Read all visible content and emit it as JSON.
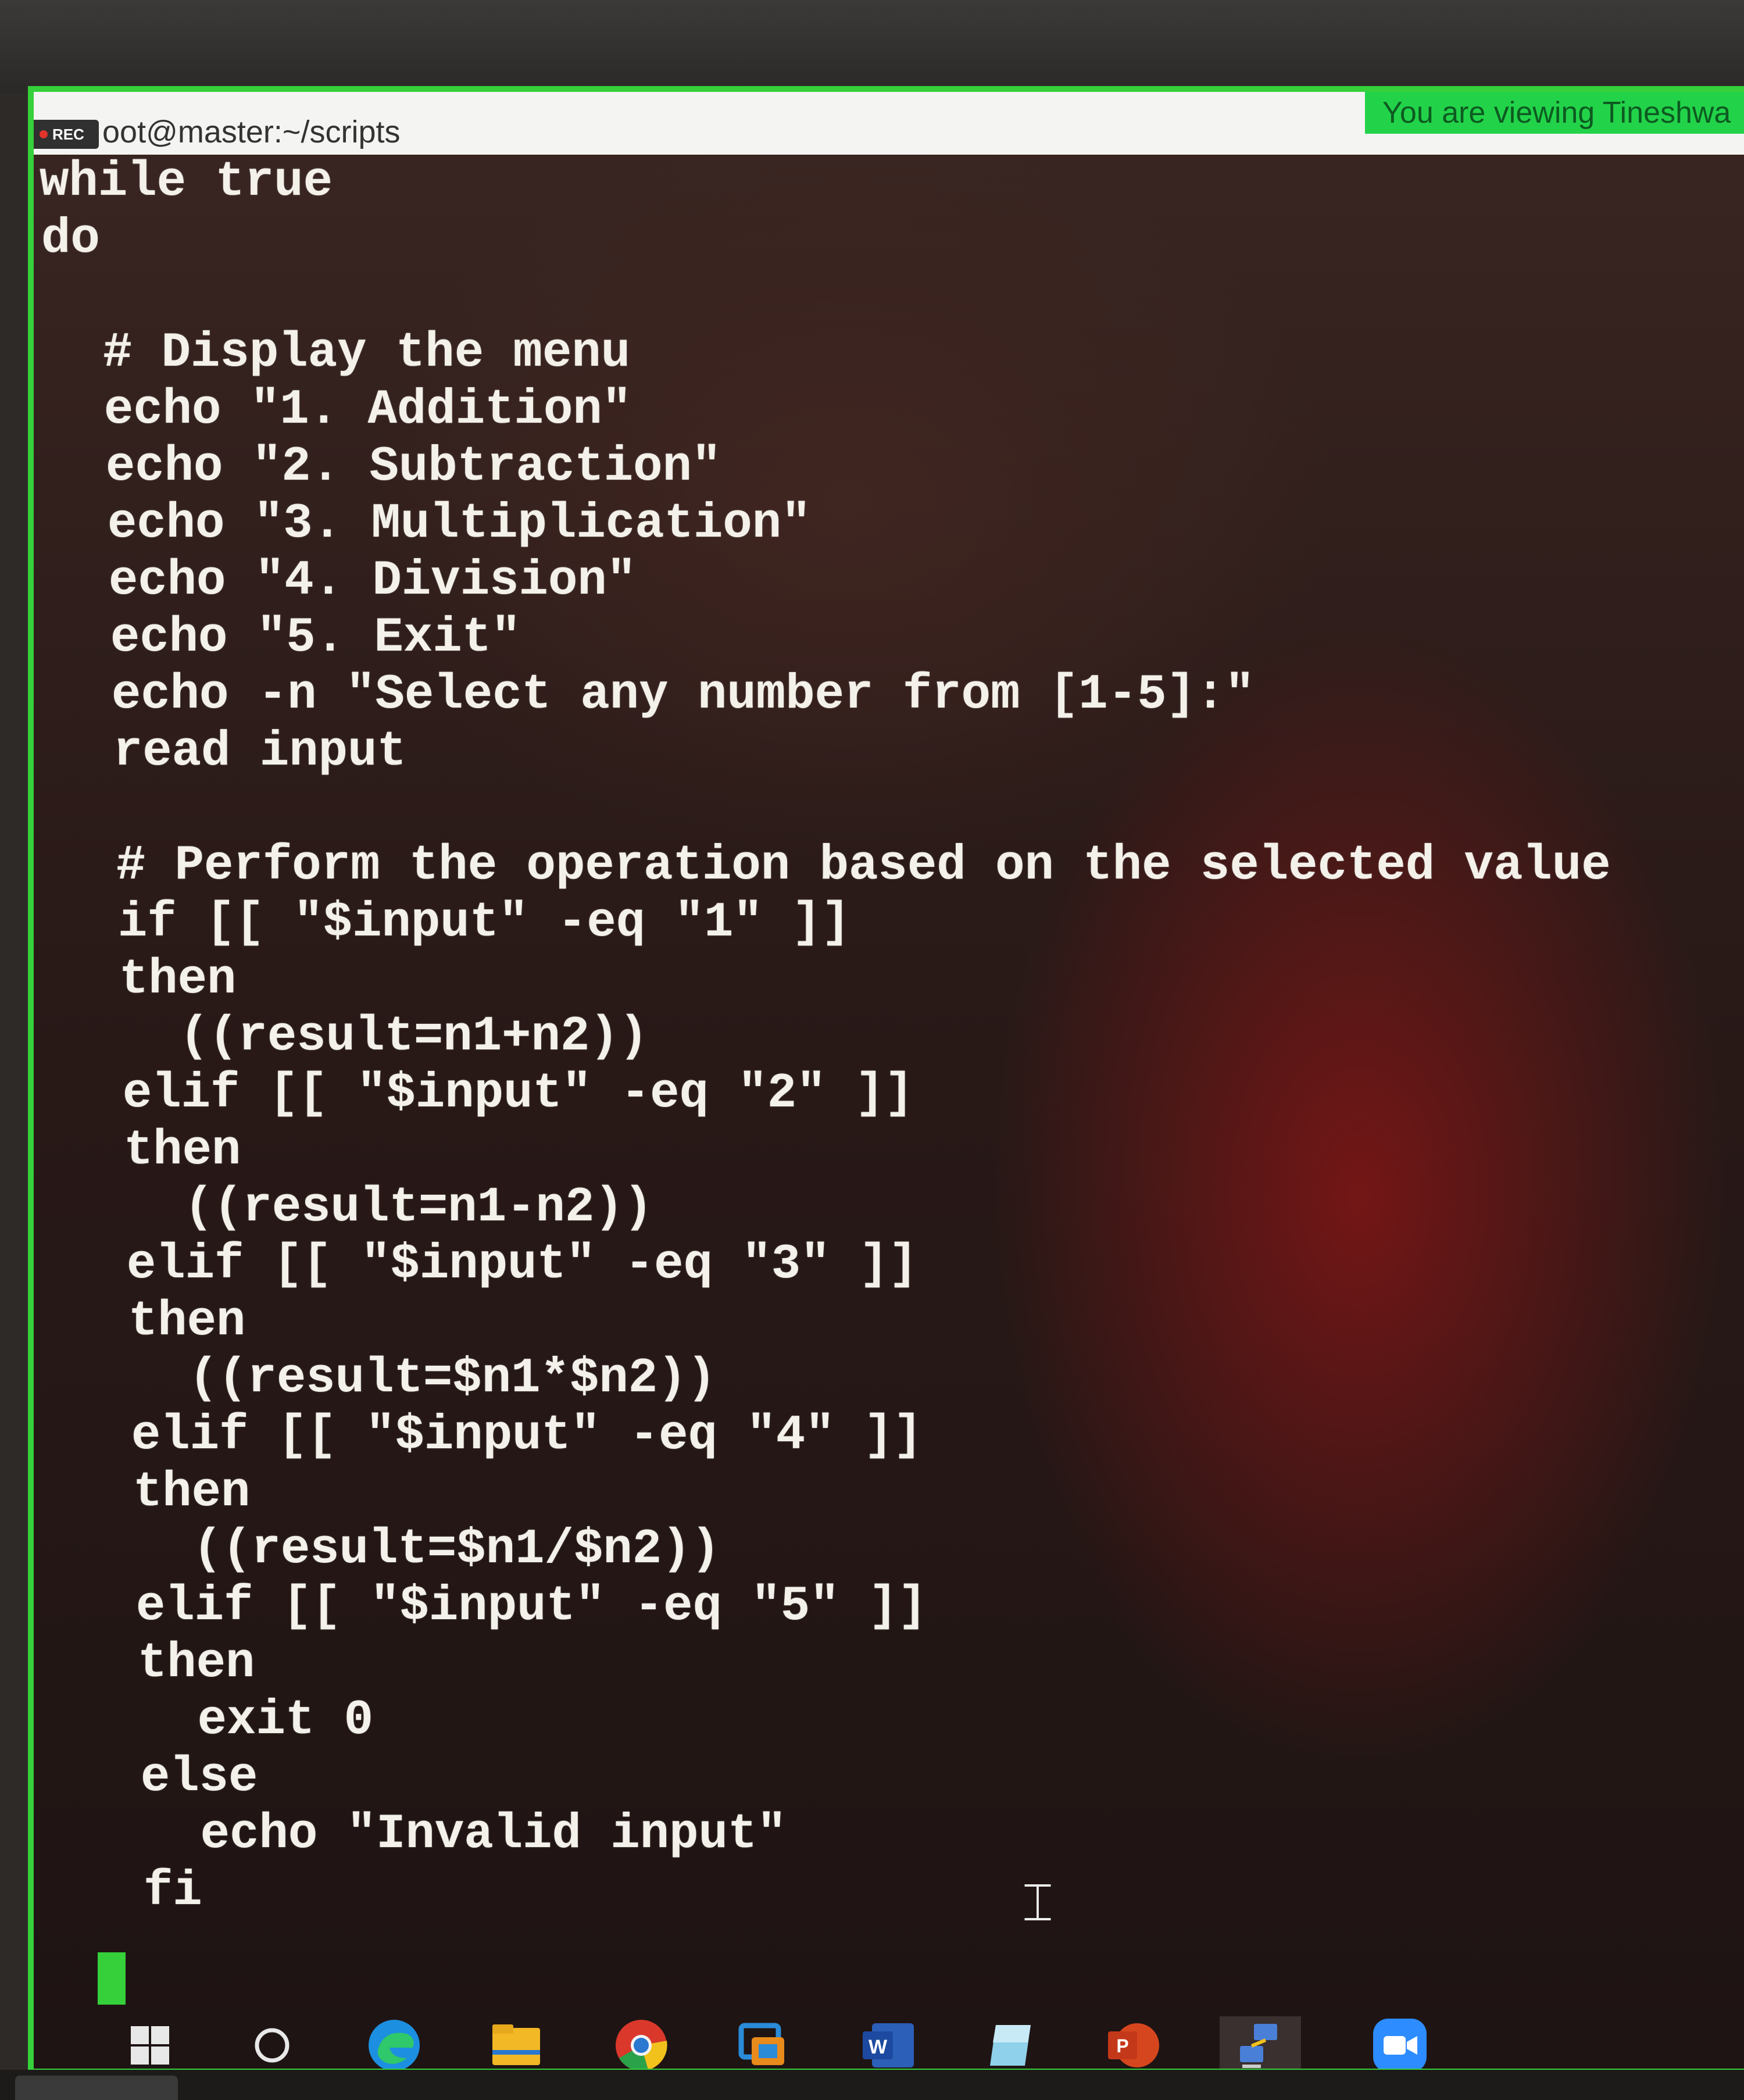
{
  "recording": {
    "label": "REC"
  },
  "window": {
    "title": "oot@master:~/scripts"
  },
  "share_banner": {
    "text": "You are viewing Tineshwa"
  },
  "code_lines": [
    "while true",
    "do",
    "",
    "  # Display the menu",
    "  echo \"1. Addition\"",
    "  echo \"2. Subtraction\"",
    "  echo \"3. Multiplication\"",
    "  echo \"4. Division\"",
    "  echo \"5. Exit\"",
    "  echo -n \"Select any number from [1-5]:\"",
    "  read input",
    "",
    "  # Perform the operation based on the selected value",
    "  if [[ \"$input\" -eq \"1\" ]]",
    "  then",
    "    ((result=n1+n2))",
    "  elif [[ \"$input\" -eq \"2\" ]]",
    "  then",
    "    ((result=n1-n2))",
    "  elif [[ \"$input\" -eq \"3\" ]]",
    "  then",
    "    ((result=$n1*$n2))",
    "  elif [[ \"$input\" -eq \"4\" ]]",
    "  then",
    "    ((result=$n1/$n2))",
    "  elif [[ \"$input\" -eq \"5\" ]]",
    "  then",
    "    exit 0",
    "  else",
    "    echo \"Invalid input\"",
    "  fi"
  ],
  "taskbar": {
    "items": [
      "windows-start-icon",
      "search-circle-icon",
      "edge-browser-icon",
      "file-explorer-icon",
      "chrome-browser-icon",
      "remote-desktop-icon",
      "word-icon",
      "app-cube-icon",
      "powerpoint-icon",
      "network-share-icon",
      "zoom-meetings-icon"
    ],
    "word_label": "W",
    "powerpoint_label": "P"
  },
  "colors": {
    "share_border": "#35d03a",
    "banner_bg": "#22d34a",
    "terminal_text": "#f3f1ea"
  }
}
